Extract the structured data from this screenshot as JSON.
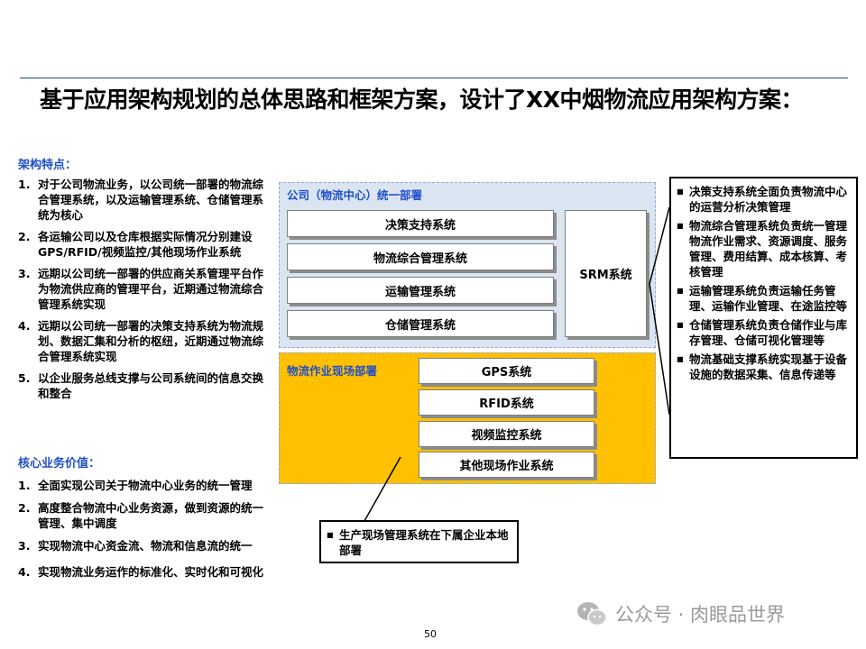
{
  "title": "基于应用架构规划的总体思路和框架方案，设计了XX中烟物流应用架构方案：",
  "features": {
    "heading": "架构特点：",
    "items": [
      {
        "num": "1.",
        "text": "对于公司物流业务，以公司统一部署的物流综合管理系统，以及运输管理系统、仓储管理系统为核心"
      },
      {
        "num": "2.",
        "text": "各运输公司以及仓库根据实际情况分别建设GPS/RFID/视频监控/其他现场作业系统"
      },
      {
        "num": "3.",
        "text": "远期以公司统一部署的供应商关系管理平台作为物流供应商的管理平台，近期通过物流综合管理系统实现"
      },
      {
        "num": "4.",
        "text": "远期以公司统一部署的决策支持系统为物流规划、数据汇集和分析的枢纽，近期通过物流综合管理系统实现"
      },
      {
        "num": "5.",
        "text": "以企业服务总线支撑与公司系统间的信息交换和整合"
      }
    ]
  },
  "values": {
    "heading": "核心业务价值：",
    "items": [
      {
        "num": "1.",
        "text": "全面实现公司关于物流中心业务的统一管理"
      },
      {
        "num": "2.",
        "text": "高度整合物流中心业务资源，做到资源的统一管理、集中调度"
      },
      {
        "num": "3.",
        "text": "实现物流中心资金流、物流和信息流的统一"
      },
      {
        "num": "4.",
        "text": "实现物流业务运作的标准化、实时化和可视化"
      }
    ]
  },
  "diagram": {
    "company_panel": {
      "label": "公司（物流中心）统一部署",
      "systems": [
        "决策支持系统",
        "物流综合管理系统",
        "运输管理系统",
        "仓储管理系统"
      ],
      "srm": "SRM系统"
    },
    "field_panel": {
      "label": "物流作业现场部署",
      "systems": [
        "GPS系统",
        "RFID系统",
        "视频监控系统",
        "其他现场作业系统"
      ]
    },
    "field_callout": "生产现场管理系统在下属企业本地部署",
    "right_callout": [
      "决策支持系统全面负责物流中心的运营分析决策管理",
      "物流综合管理系统负责统一管理物流作业需求、资源调度、服务管理、费用结算、成本核算、考核管理",
      "运输管理系统负责运输任务管理、运输作业管理、在途监控等",
      "仓储管理系统负责仓储作业与库存管理、仓储可视化管理等",
      "物流基础支撑系统实现基于设备设施的数据采集、信息传递等"
    ]
  },
  "page_number": "50",
  "watermark": "公众号 · 肉眼品世界",
  "colors": {
    "heading_blue": "#1f4ec9",
    "panel_blue": "#dbe5f1",
    "panel_gold": "#ffc000"
  }
}
